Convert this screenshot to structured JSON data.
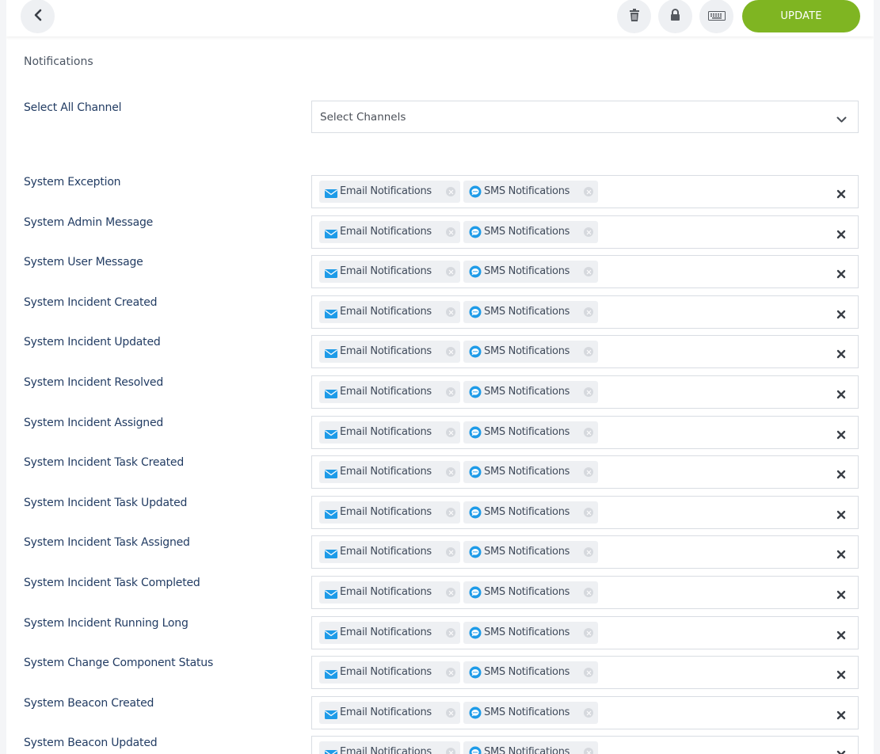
{
  "toolbar": {
    "back_icon": "chevron-left-icon",
    "delete_icon": "trash-icon",
    "lock_icon": "lock-icon",
    "keyboard_icon": "keyboard-icon",
    "update_label": "UPDATE"
  },
  "section": {
    "title": "Notifications"
  },
  "select_all": {
    "label": "Select All Channel",
    "placeholder": "Select Channels"
  },
  "colors": {
    "accent": "#7fb522",
    "label": "#223c63",
    "email_icon": "#1e9be8",
    "sms_icon": "#1e9be8"
  },
  "tags": {
    "email": "Email Notifications",
    "sms": "SMS Notifications"
  },
  "rows": [
    {
      "label": "System Exception"
    },
    {
      "label": "System Admin Message"
    },
    {
      "label": "System User Message"
    },
    {
      "label": "System Incident Created"
    },
    {
      "label": "System Incident Updated"
    },
    {
      "label": "System Incident Resolved"
    },
    {
      "label": "System Incident Assigned"
    },
    {
      "label": "System Incident Task Created"
    },
    {
      "label": "System Incident Task Updated"
    },
    {
      "label": "System Incident Task Assigned"
    },
    {
      "label": "System Incident Task Completed"
    },
    {
      "label": "System Incident Running Long"
    },
    {
      "label": "System Change Component Status"
    },
    {
      "label": "System Beacon Created"
    },
    {
      "label": "System Beacon Updated"
    }
  ]
}
